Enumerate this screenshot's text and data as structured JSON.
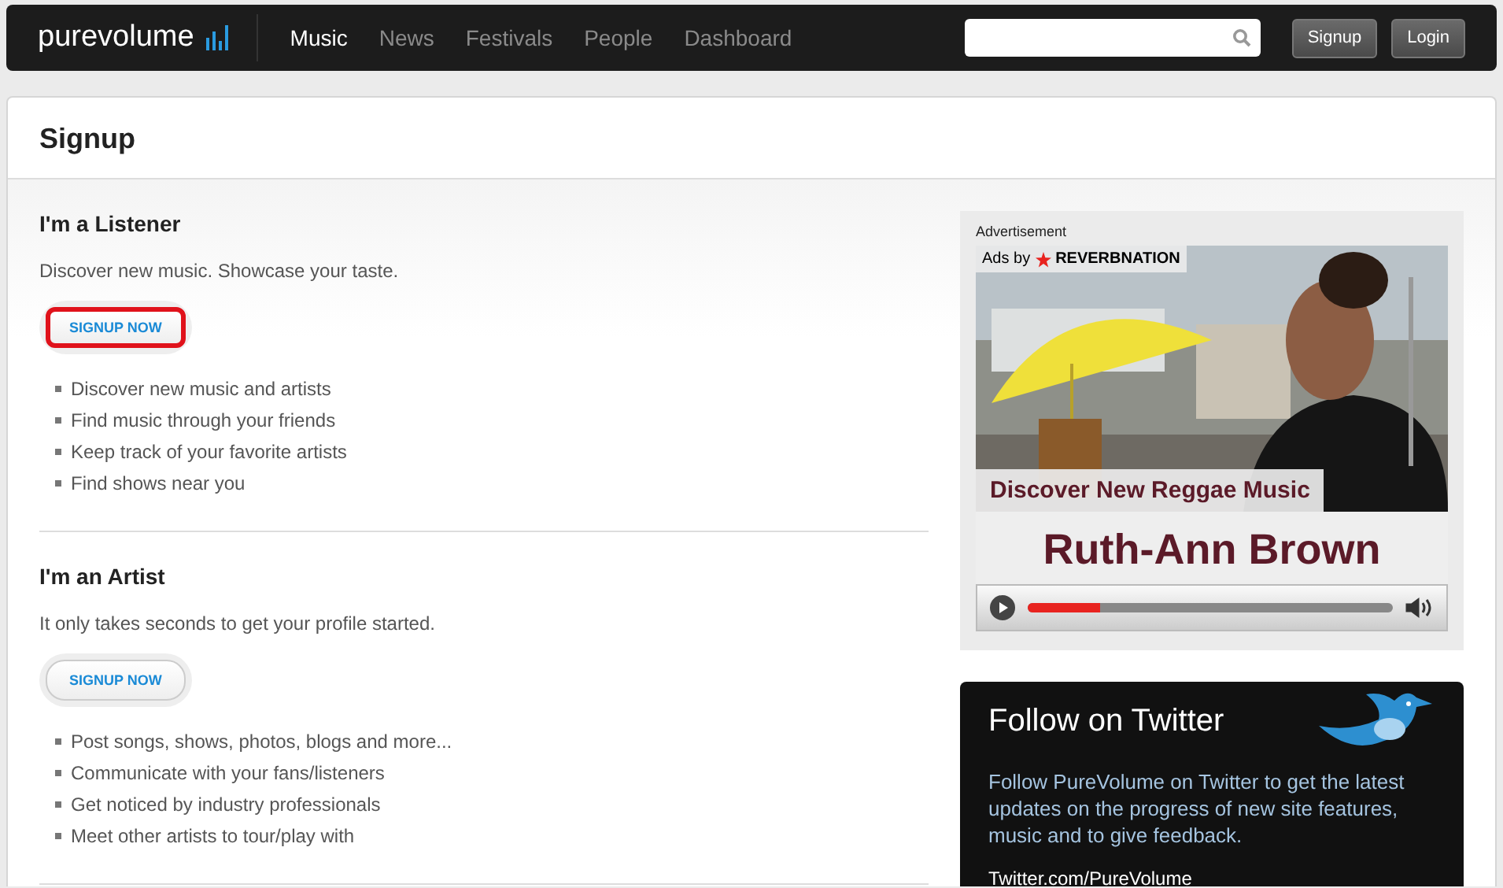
{
  "nav": {
    "logo": "purevolume",
    "links": [
      {
        "label": "Music",
        "selected": true
      },
      {
        "label": "News",
        "selected": false
      },
      {
        "label": "Festivals",
        "selected": false
      },
      {
        "label": "People",
        "selected": false
      },
      {
        "label": "Dashboard",
        "selected": false
      }
    ],
    "buttons": [
      "Signup",
      "Login"
    ]
  },
  "page": {
    "title": "Signup"
  },
  "sections": [
    {
      "heading": "I'm a Listener",
      "intro": "Discover new music. Showcase your taste.",
      "button": "SIGNUP NOW",
      "highlighted": true,
      "items": [
        "Discover new music and artists",
        "Find music through your friends",
        "Keep track of your favorite artists",
        "Find shows near you"
      ]
    },
    {
      "heading": "I'm an Artist",
      "intro": "It only takes seconds to get your profile started.",
      "button": "SIGNUP NOW",
      "highlighted": false,
      "items": [
        "Post songs, shows, photos, blogs and more...",
        "Communicate with your fans/listeners",
        "Get noticed by industry professionals",
        "Meet other artists to tour/play with"
      ]
    }
  ],
  "ad": {
    "label": "Advertisement",
    "ads_by": "Ads by",
    "brand": "REVERBNATION",
    "caption": "Discover New Reggae Music",
    "artist": "Ruth-Ann Brown",
    "player": {
      "level": 0.2
    }
  },
  "twitter": {
    "title": "Follow on Twitter",
    "text": "Follow PureVolume on Twitter to get the latest updates on the progress of new site features, music and to give feedback.",
    "link": "Twitter.com/PureVolume"
  }
}
